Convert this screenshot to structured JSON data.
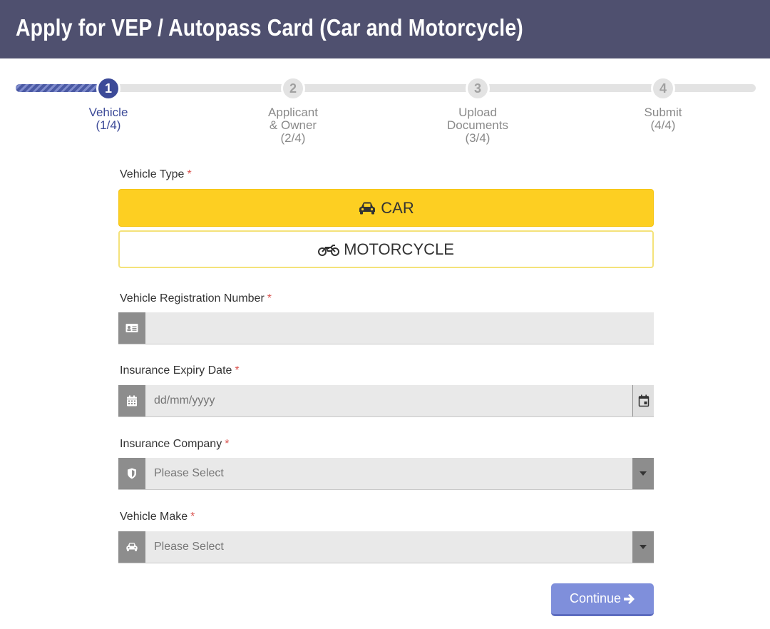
{
  "header": {
    "title": "Apply for VEP / Autopass Card (Car and Motorcycle)"
  },
  "steps": [
    {
      "number": "1",
      "label_lines": [
        "Vehicle",
        "(1/4)"
      ]
    },
    {
      "number": "2",
      "label_lines": [
        "Applicant",
        "& Owner",
        "(2/4)"
      ]
    },
    {
      "number": "3",
      "label_lines": [
        "Upload",
        "Documents",
        "(3/4)"
      ]
    },
    {
      "number": "4",
      "label_lines": [
        "Submit",
        "(4/4)"
      ]
    }
  ],
  "progress_fraction": 0.11,
  "form": {
    "vehicle_type": {
      "label": "Vehicle Type",
      "required": "*",
      "options": [
        "CAR",
        "MOTORCYCLE"
      ],
      "selected": "CAR"
    },
    "registration": {
      "label": "Vehicle Registration Number",
      "required": "*",
      "value": ""
    },
    "insurance_expiry": {
      "label": "Insurance Expiry Date",
      "required": "*",
      "placeholder": "dd/mm/yyyy"
    },
    "insurance_company": {
      "label": "Insurance Company",
      "required": "*",
      "value": "Please Select"
    },
    "vehicle_make": {
      "label": "Vehicle Make",
      "required": "*",
      "value": "Please Select"
    }
  },
  "continue_label": "Continue",
  "colors": {
    "header": "#4f506f",
    "accent": "#3c4a98",
    "car_button": "#fdcf22",
    "continue": "#7f8fdb",
    "required": "#d9534f"
  },
  "icons": [
    "car-icon",
    "motorcycle-icon",
    "id-card-icon",
    "calendar-icon",
    "calendar-picker-icon",
    "shield-icon",
    "car-small-icon",
    "dropdown-caret-icon",
    "arrow-right-icon"
  ]
}
